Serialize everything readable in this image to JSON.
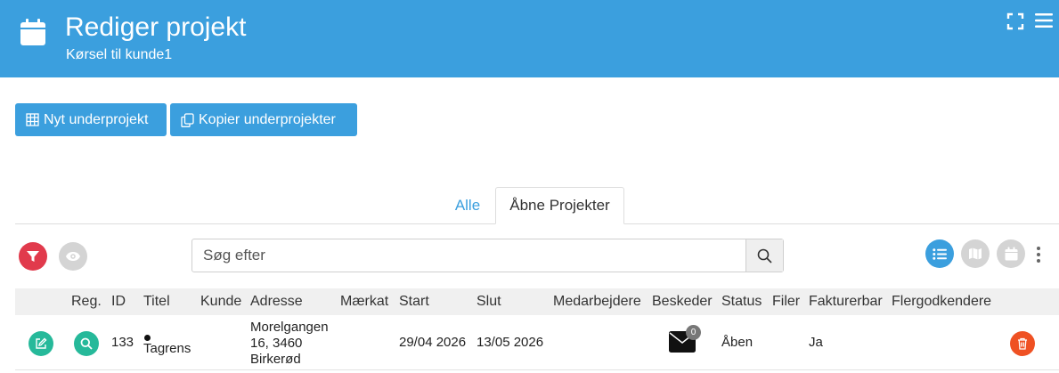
{
  "header": {
    "title": "Rediger projekt",
    "subtitle": "Kørsel til kunde1",
    "background_color": "#3b9fde",
    "icons": [
      "calendar-icon",
      "fullscreen-icon",
      "menu-icon"
    ]
  },
  "toolbar": {
    "new_subproject_label": "Nyt underprojekt",
    "copy_subprojects_label": "Kopier underprojekter",
    "new_icon": "table-grid-icon",
    "copy_icon": "copy-icon"
  },
  "tabs": [
    {
      "label": "Alle",
      "active": false
    },
    {
      "label": "Åbne Projekter",
      "active": true
    }
  ],
  "filters": {
    "filter_icon": "filter-icon",
    "filter_color": "#e13a4c",
    "eye_icon": "eye-icon"
  },
  "search": {
    "placeholder": "Søg efter",
    "value": ""
  },
  "view_toggles": {
    "list_icon": "list-icon",
    "map_icon": "map-icon",
    "calendar_icon": "calendar-icon",
    "active": "list"
  },
  "table": {
    "columns": [
      "Reg.",
      "ID",
      "Titel",
      "Kunde",
      "Adresse",
      "Mærkat",
      "Start",
      "Slut",
      "Medarbejdere",
      "Beskeder",
      "Status",
      "Filer",
      "Fakturerbar",
      "Flergodkendere"
    ],
    "rows": [
      {
        "id": "133",
        "title": "Tagrens",
        "customer": "",
        "address_lines": [
          "Morelgangen",
          "16, 3460",
          "Birkerød"
        ],
        "label": "",
        "start": "29/04 2026",
        "end": "13/05 2026",
        "employees": "",
        "messages_count": "0",
        "status": "Åben",
        "files": "",
        "billable": "Ja",
        "multi_approvers": ""
      }
    ]
  },
  "colors": {
    "primary": "#3b9fde",
    "success": "#26b99a",
    "danger": "#ef5123",
    "filter_red": "#e13a4c",
    "inactive_gray": "#d4d4d4"
  }
}
